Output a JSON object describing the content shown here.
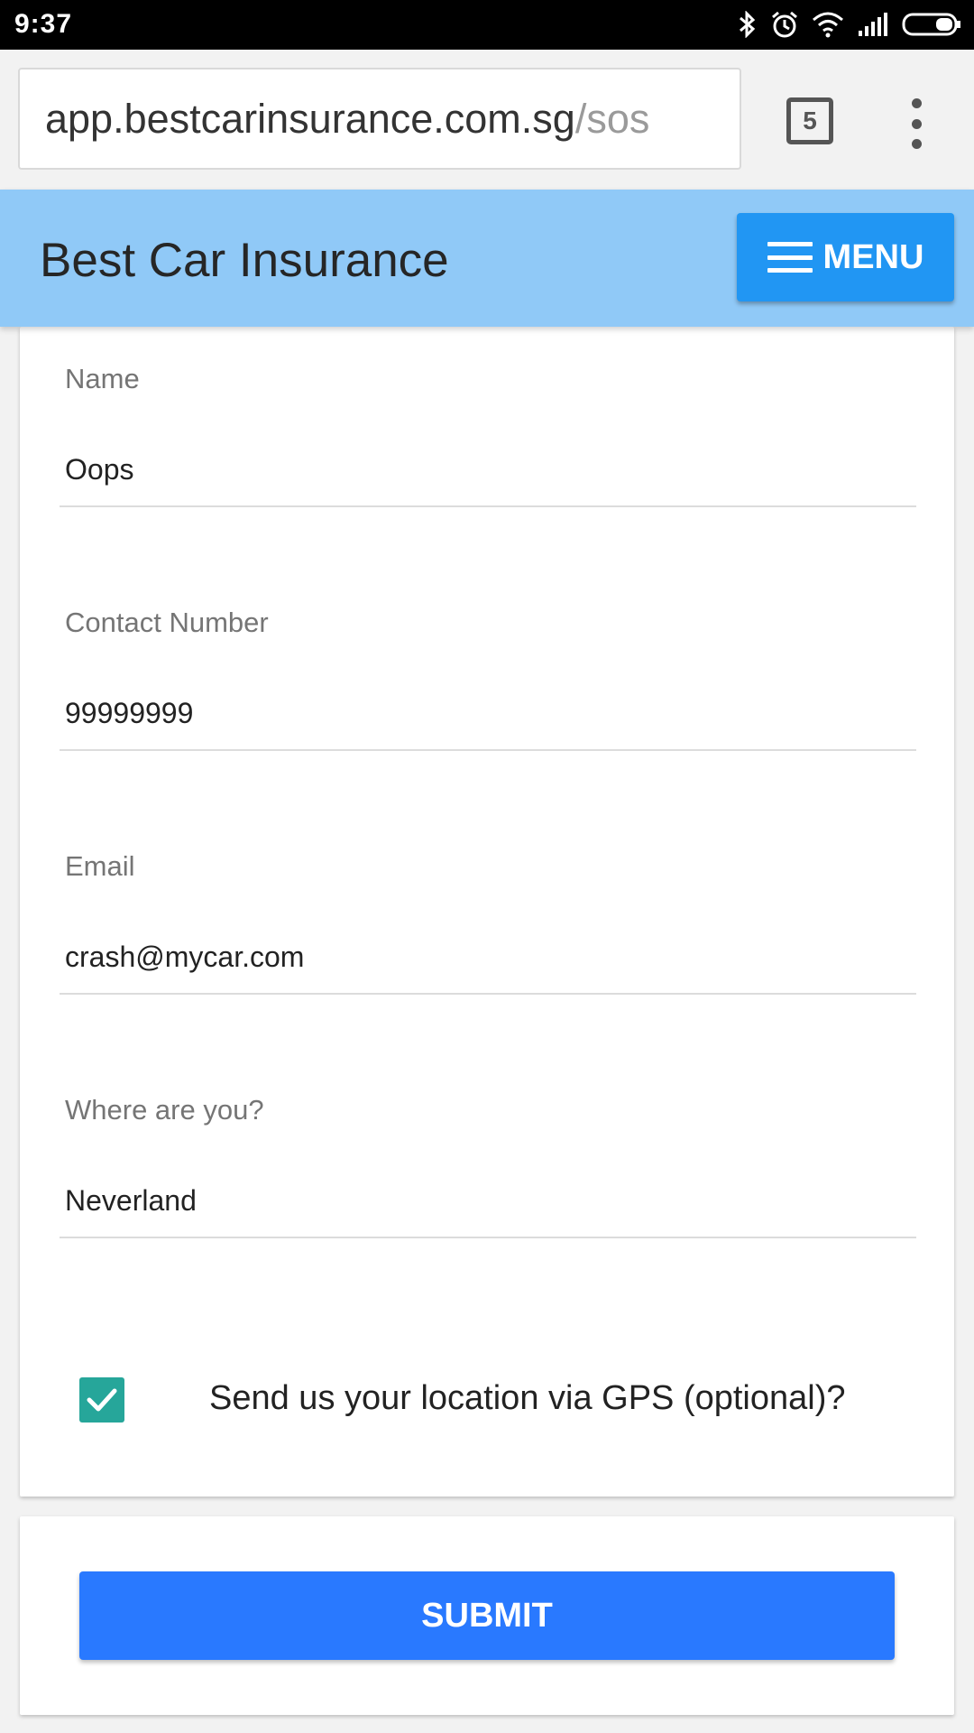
{
  "status_bar": {
    "time": "9:37",
    "icons": [
      "bluetooth-icon",
      "alarm-icon",
      "wifi-icon",
      "signal-icon",
      "battery-icon"
    ]
  },
  "browser": {
    "url_domain": "app.bestcarinsurance.com.sg",
    "url_path": "/sos",
    "tab_count": "5",
    "overflow_icon": "more-vert-icon"
  },
  "header": {
    "title": "Best Car Insurance",
    "menu_label": "MENU",
    "menu_icon": "hamburger-icon",
    "color": "#90c9f7",
    "menu_color": "#2196f3"
  },
  "form": {
    "fields": [
      {
        "label": "Name",
        "value": "Oops"
      },
      {
        "label": "Contact Number",
        "value": "99999999"
      },
      {
        "label": "Email",
        "value": "crash@mycar.com"
      },
      {
        "label": "Where are you?",
        "value": "Neverland"
      }
    ],
    "gps": {
      "label": "Send us your location via GPS (optional)?",
      "checked": true,
      "checkbox_color": "#26a69a"
    }
  },
  "submit": {
    "label": "SUBMIT",
    "color": "#2979ff"
  }
}
